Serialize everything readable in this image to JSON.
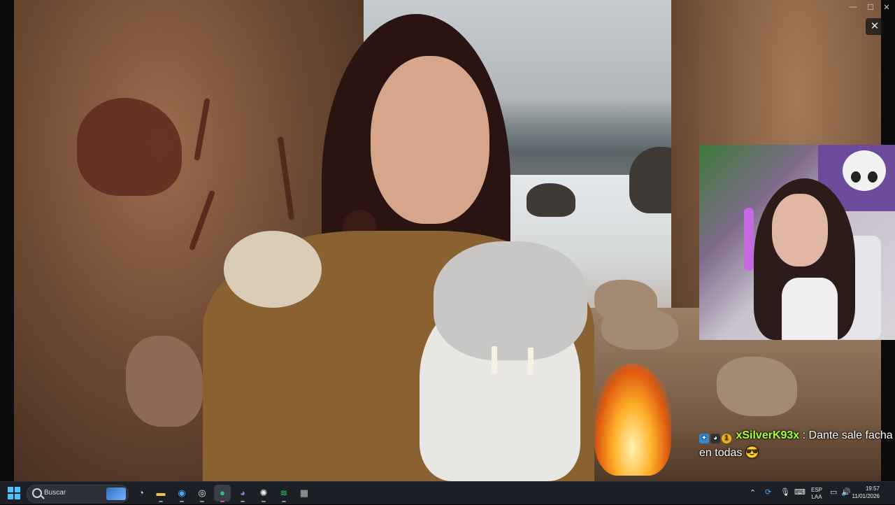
{
  "chat": {
    "username": "xSilverK93x",
    "separator": ":",
    "message_line1": "Dante sale facha",
    "message_line2": "en todas",
    "emote": "😎",
    "badges": [
      "partner-badge",
      "cat-badge",
      "sub-badge"
    ]
  },
  "overlay": {
    "close_glyph": "✕"
  },
  "window_controls": {
    "minimize": "—",
    "maximize": "☐",
    "close": "✕"
  },
  "taskbar": {
    "search_placeholder": "Buscar",
    "pinned_apps": [
      {
        "name": "widgets-icon",
        "glyph": "◔"
      },
      {
        "name": "file-explorer-icon",
        "glyph": "▬"
      },
      {
        "name": "chrome-icon",
        "glyph": "◉"
      },
      {
        "name": "obs-icon",
        "glyph": "◎"
      },
      {
        "name": "streamlabs-icon",
        "glyph": "●"
      },
      {
        "name": "discord-icon",
        "glyph": "◕"
      },
      {
        "name": "settings-icon",
        "glyph": "✺"
      },
      {
        "name": "spotify-icon",
        "glyph": "≋"
      },
      {
        "name": "app-icon",
        "glyph": "▦"
      }
    ],
    "tray": {
      "language": "ESP",
      "layout": "LAA",
      "time": "19:57",
      "date": "11/01/2026"
    }
  }
}
